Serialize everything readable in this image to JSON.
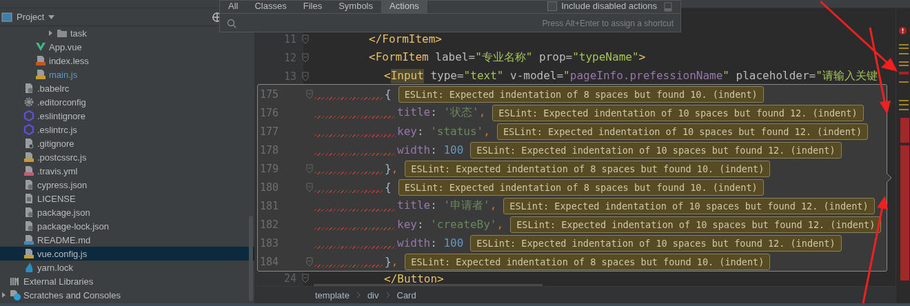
{
  "project_panel": {
    "title": "Project"
  },
  "tree": {
    "folders": [
      {
        "label": "task",
        "kind": "folder",
        "expanded": false,
        "selected": false,
        "modified": false
      }
    ],
    "src_files": [
      {
        "label": "App.vue",
        "kind": "vue",
        "selected": false,
        "modified": false
      },
      {
        "label": "index.less",
        "kind": "less",
        "selected": false,
        "modified": false
      },
      {
        "label": "main.js",
        "kind": "js",
        "selected": false,
        "modified": true
      }
    ],
    "project_files": [
      {
        "label": ".babelrc",
        "kind": "config",
        "selected": false,
        "modified": false
      },
      {
        "label": ".editorconfig",
        "kind": "gear",
        "selected": false,
        "modified": false
      },
      {
        "label": ".eslintignore",
        "kind": "eslint",
        "selected": false,
        "modified": false
      },
      {
        "label": ".eslintrc.js",
        "kind": "eslint",
        "selected": false,
        "modified": false
      },
      {
        "label": ".gitignore",
        "kind": "gitignore",
        "selected": false,
        "modified": false
      },
      {
        "label": ".postcssrc.js",
        "kind": "js",
        "selected": false,
        "modified": false
      },
      {
        "label": ".travis.yml",
        "kind": "yml",
        "selected": false,
        "modified": false
      },
      {
        "label": "cypress.json",
        "kind": "config",
        "selected": false,
        "modified": false
      },
      {
        "label": "LICENSE",
        "kind": "text",
        "selected": false,
        "modified": false
      },
      {
        "label": "package.json",
        "kind": "config",
        "selected": false,
        "modified": false
      },
      {
        "label": "package-lock.json",
        "kind": "config",
        "selected": false,
        "modified": false
      },
      {
        "label": "README.md",
        "kind": "md",
        "selected": false,
        "modified": false
      },
      {
        "label": "vue.config.js",
        "kind": "js",
        "selected": true,
        "modified": false
      },
      {
        "label": "yarn.lock",
        "kind": "yarn",
        "selected": false,
        "modified": false
      }
    ],
    "roots": [
      {
        "label": "External Libraries",
        "kind": "libraries",
        "selected": false,
        "modified": false
      },
      {
        "label": "Scratches and Consoles",
        "kind": "scratches",
        "expanded": false,
        "selected": false,
        "modified": false
      }
    ]
  },
  "search_popup": {
    "tabs": [
      {
        "label": "All",
        "selected": false
      },
      {
        "label": "Classes",
        "selected": false
      },
      {
        "label": "Files",
        "selected": false
      },
      {
        "label": "Symbols",
        "selected": false
      },
      {
        "label": "Actions",
        "selected": true
      }
    ],
    "include_disabled": {
      "label": "Include disabled actions",
      "checked": false
    },
    "hint": "Press Alt+Enter to assign a shortcut"
  },
  "code_lines_top": [
    {
      "number": "11",
      "kind": "outer",
      "tokens": [
        {
          "text": "</FormItem>",
          "kind": "tag"
        }
      ]
    },
    {
      "number": "12",
      "kind": "outer",
      "tokens": [
        {
          "text": "<FormItem",
          "kind": "tag"
        },
        {
          "text": " label=",
          "kind": "attr"
        },
        {
          "text": "\"专业名称\"",
          "kind": "value"
        },
        {
          "text": " prop=",
          "kind": "attr"
        },
        {
          "text": "\"typeName\"",
          "kind": "value"
        },
        {
          "text": ">",
          "kind": "tag"
        }
      ]
    },
    {
      "number": "13",
      "kind": "inner",
      "tokens": [
        {
          "text": "<",
          "kind": "tag"
        },
        {
          "text": "Input",
          "kind": "tag-match"
        },
        {
          "text": " type=",
          "kind": "attr"
        },
        {
          "text": "\"text\"",
          "kind": "value"
        },
        {
          "text": " v-model=",
          "kind": "attr"
        },
        {
          "text": "\"",
          "kind": "value"
        },
        {
          "text": "pageInfo.prefessionName",
          "kind": "variable"
        },
        {
          "text": "\"",
          "kind": "value"
        },
        {
          "text": " placeholder=",
          "kind": "attr"
        },
        {
          "text": "\"请输入关键",
          "kind": "value"
        }
      ]
    }
  ],
  "lint_popup": {
    "lines": [
      {
        "number": "175",
        "kind": "brace",
        "tokens": [
          {
            "text": "{",
            "kind": "plain"
          }
        ],
        "message": "ESLint: Expected indentation of 8 spaces but found 10. (indent)"
      },
      {
        "number": "176",
        "kind": "property",
        "tokens": [
          {
            "text": "title",
            "kind": "key"
          },
          {
            "text": ": ",
            "kind": "plain"
          },
          {
            "text": "'状态'",
            "kind": "string"
          },
          {
            "text": ",",
            "kind": "punct"
          }
        ],
        "message": "ESLint: Expected indentation of 10 spaces but found 12. (indent)"
      },
      {
        "number": "177",
        "kind": "property",
        "tokens": [
          {
            "text": "key",
            "kind": "key"
          },
          {
            "text": ": ",
            "kind": "plain"
          },
          {
            "text": "'status'",
            "kind": "string"
          },
          {
            "text": ",",
            "kind": "punct"
          }
        ],
        "message": "ESLint: Expected indentation of 10 spaces but found 12. (indent)"
      },
      {
        "number": "178",
        "kind": "property",
        "tokens": [
          {
            "text": "width",
            "kind": "key"
          },
          {
            "text": ": ",
            "kind": "plain"
          },
          {
            "text": "100",
            "kind": "number"
          }
        ],
        "message": "ESLint: Expected indentation of 10 spaces but found 12. (indent)"
      },
      {
        "number": "179",
        "kind": "brace",
        "tokens": [
          {
            "text": "}",
            "kind": "plain"
          },
          {
            "text": ",",
            "kind": "punct"
          }
        ],
        "message": "ESLint: Expected indentation of 8 spaces but found 10. (indent)"
      },
      {
        "number": "180",
        "kind": "brace",
        "tokens": [
          {
            "text": "{",
            "kind": "plain"
          }
        ],
        "message": "ESLint: Expected indentation of 8 spaces but found 10. (indent)"
      },
      {
        "number": "181",
        "kind": "property",
        "tokens": [
          {
            "text": "title",
            "kind": "key"
          },
          {
            "text": ": ",
            "kind": "plain"
          },
          {
            "text": "'申请者'",
            "kind": "string"
          },
          {
            "text": ",",
            "kind": "punct"
          }
        ],
        "message": "ESLint: Expected indentation of 10 spaces but found 12. (indent)"
      },
      {
        "number": "182",
        "kind": "property",
        "tokens": [
          {
            "text": "key",
            "kind": "key"
          },
          {
            "text": ": ",
            "kind": "plain"
          },
          {
            "text": "'createBy'",
            "kind": "string"
          },
          {
            "text": ",",
            "kind": "punct"
          }
        ],
        "message": "ESLint: Expected indentation of 10 spaces but found 12. (indent)"
      },
      {
        "number": "183",
        "kind": "property",
        "tokens": [
          {
            "text": "width",
            "kind": "key"
          },
          {
            "text": ": ",
            "kind": "plain"
          },
          {
            "text": "100",
            "kind": "number"
          }
        ],
        "message": "ESLint: Expected indentation of 10 spaces but found 12. (indent)"
      },
      {
        "number": "184",
        "kind": "brace",
        "tokens": [
          {
            "text": "}",
            "kind": "plain"
          },
          {
            "text": ",",
            "kind": "punct"
          }
        ],
        "message": "ESLint: Expected indentation of 8 spaces but found 10. (indent)"
      }
    ]
  },
  "code_lines_bottom": [
    {
      "number": "24",
      "kind": "inner",
      "tokens": [
        {
          "text": "</Button>",
          "kind": "tag"
        }
      ]
    }
  ],
  "breadcrumbs": [
    "template",
    "div",
    "Card"
  ]
}
